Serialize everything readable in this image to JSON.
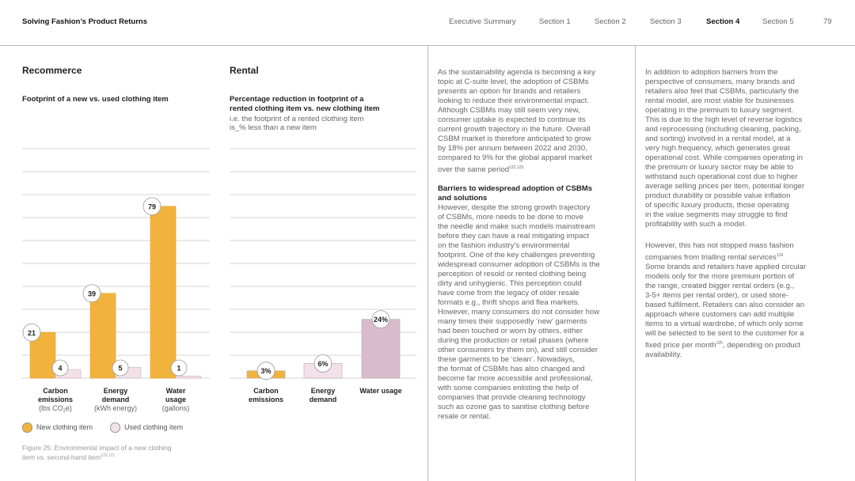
{
  "header": {
    "doc_title": "Solving Fashion’s Product Returns",
    "nav": [
      "Executive Summary",
      "Section 1",
      "Section 2",
      "Section 3",
      "Section 4",
      "Section 5"
    ],
    "page_number": "79"
  },
  "recommerce": {
    "heading": "Recommerce",
    "subheading": "Footprint of a new vs. used clothing item"
  },
  "rental": {
    "heading": "Rental",
    "subheading_line1": "Percentage reduction in footprint of a",
    "subheading_line2": "rented clothing item vs. new clothing item",
    "note_line1": "i.e. the footprint of a rented clothing item",
    "note_line2": "is_% less than a new item"
  },
  "chart_data": [
    {
      "type": "bar",
      "categories": [
        "Carbon emissions",
        "Energy demand",
        "Water usage"
      ],
      "units": [
        "(lbs CO₂e)",
        "(kWh energy)",
        "(gallons)"
      ],
      "series": [
        {
          "name": "New clothing item",
          "values": [
            21,
            39,
            79
          ],
          "color": "#F2B33D"
        },
        {
          "name": "Used clothing item",
          "values": [
            4,
            5,
            1
          ],
          "color": "#F3E1EA"
        }
      ],
      "legend": "bottom-left",
      "grid": true
    },
    {
      "type": "bar",
      "categories": [
        "Carbon emissions",
        "Energy demand",
        "Water usage"
      ],
      "values": [
        3,
        6,
        24
      ],
      "labels": [
        "3%",
        "6%",
        "24%"
      ],
      "colors": [
        "#F2B33D",
        "#F3E1EA",
        "#D9BCCB"
      ],
      "grid": true
    }
  ],
  "legend": {
    "new_label": "New clothing item",
    "used_label": "Used clothing item"
  },
  "caption": {
    "line1": "Figure 25: Environmental impact of a new clothing",
    "line2": "item vs. second-hand item",
    "refs": "120,121"
  },
  "col3": {
    "p1_lines": [
      "As the sustainability agenda is becoming a key",
      "topic at C-suite level, the adoption of CSBMs",
      "presents an option for brands and retailers",
      "looking to reduce their environmental impact.",
      "Although CSBMs may still seem very new,",
      "consumer uptake is expected to continue its",
      "current growth trajectory in the future. Overall",
      "CSBM market is therefore anticipated to grow",
      "by 18% per annum between 2022 and 2030,",
      "compared to 9% for the global apparel market",
      "over the same period"
    ],
    "p1_refs": "122,123",
    "heading_lines": [
      "Barriers to widespread adoption of CSBMs",
      "and solutions"
    ],
    "p2_lines": [
      "However, despite the strong growth trajectory",
      "of CSBMs, more needs to be done to move",
      "the needle and make such models mainstream",
      "before they can have a real mitigating impact",
      "on the fashion industry’s environmental",
      "footprint. One of the key challenges preventing",
      "widespread consumer adoption of CSBMs is the",
      "perception of resold or rented clothing being",
      "dirty and unhygienic. This perception could",
      "have come from the legacy of older resale",
      "formats e.g., thrift shops and flea markets.",
      "However, many consumers do not consider how",
      "many times their supposedly ‘new’ garments",
      "had been touched or worn by others, either",
      "during the production or retail phases (where",
      "other consumers try them on), and still consider",
      "these garments to be ‘clean’. Nowadays,",
      "the format of CSBMs has also changed and",
      "become far more accessible and professional,",
      "with some companies enlisting the help of",
      "companies that provide cleaning technology",
      "such as ozone gas to sanitise clothing before",
      "resale or rental."
    ]
  },
  "col4": {
    "p1_lines": [
      "In addition to adoption barriers from the",
      "perspective of consumers, many brands and",
      "retailers also feel that CSBMs, particularly the",
      "rental model, are most viable for businesses",
      "operating in the premium to luxury segment.",
      "This is due to the high level of reverse logistics",
      "and reprocessing (including cleaning, packing,",
      "and sorting) involved in a rental model, at a",
      "very high frequency, which generates great",
      "operational cost. While companies operating in",
      "the premium or luxury sector may be able to",
      "withstand such operational cost due to higher",
      "average selling prices per item, potential longer",
      "product durability or possible value inflation",
      "of specific luxury products, those operating",
      "in the value segments may struggle to find",
      "profitability with such a model."
    ],
    "p2_lines": [
      "However, this has not stopped mass fashion",
      "companies from trialling rental services",
      "Some brands and retailers have applied circular",
      "models only for the more premium portion of",
      "the range, created bigger rental orders (e.g.,",
      "3-5+ items per rental order), or used store-",
      "based fulfilment. Retailers can also consider an",
      "approach where customers can add multiple",
      "items to a virtual wardrobe, of which only some",
      "will be selected to be sent to the customer for a",
      "fixed price per month",
      "availability."
    ],
    "p2_ref1": "124",
    "p2_ref2": "125",
    "p2_after_ref2": ", depending on product"
  }
}
